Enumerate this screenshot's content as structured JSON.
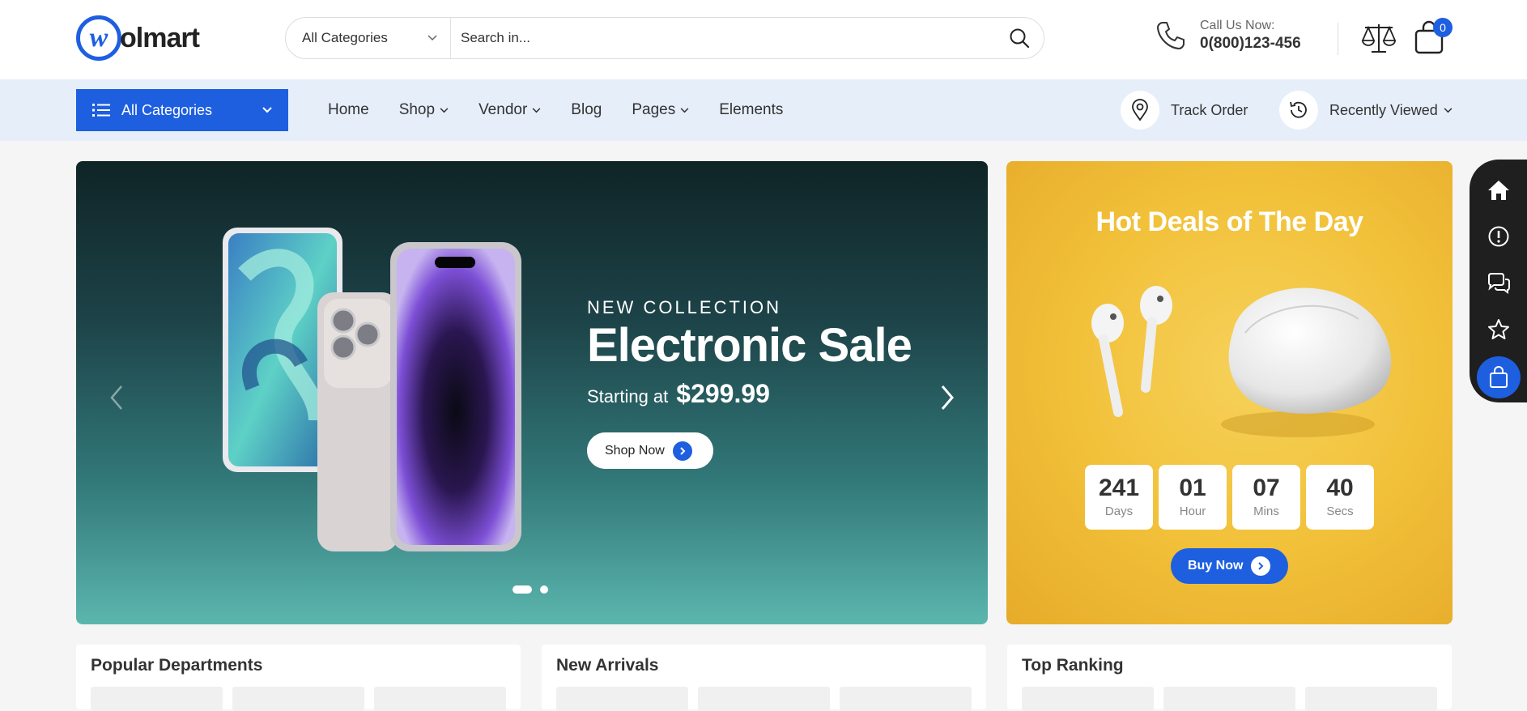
{
  "header": {
    "logo_letter": "w",
    "logo_text": "olmart",
    "search": {
      "category": "All Categories",
      "placeholder": "Search in..."
    },
    "call": {
      "label": "Call Us Now:",
      "phone": "0(800)123-456"
    },
    "cart_count": "0"
  },
  "nav": {
    "all_categories": "All Categories",
    "menu": [
      {
        "label": "Home"
      },
      {
        "label": "Shop"
      },
      {
        "label": "Vendor"
      },
      {
        "label": "Blog"
      },
      {
        "label": "Pages"
      },
      {
        "label": "Elements"
      }
    ],
    "track_order": "Track Order",
    "recently_viewed": "Recently Viewed"
  },
  "hero": {
    "kicker": "NEW COLLECTION",
    "title": "Electronic Sale",
    "starting": "Starting at",
    "price": "$299.99",
    "button": "Shop Now"
  },
  "deals": {
    "title": "Hot Deals of The Day",
    "countdown": [
      {
        "value": "241",
        "unit": "Days"
      },
      {
        "value": "01",
        "unit": "Hour"
      },
      {
        "value": "07",
        "unit": "Mins"
      },
      {
        "value": "40",
        "unit": "Secs"
      }
    ],
    "button": "Buy Now"
  },
  "sections": [
    {
      "title": "Popular Departments"
    },
    {
      "title": "New Arrivals"
    },
    {
      "title": "Top Ranking"
    }
  ],
  "colors": {
    "accent": "#1e5fe0",
    "nav_bg": "#e6eefa",
    "deals_bg": "#f2c13a"
  }
}
